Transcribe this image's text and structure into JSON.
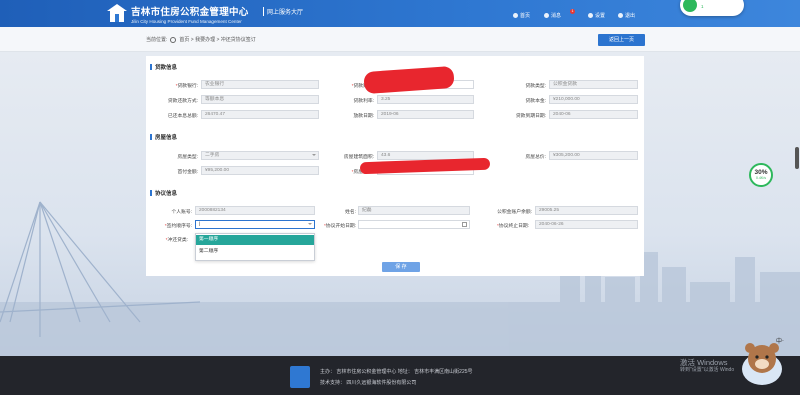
{
  "header": {
    "title_cn": "吉林市住房公积金管理中心",
    "title_en": "Jilin City Housing Provident Fund Management Center",
    "sub": "网上服务大厅",
    "nav": [
      {
        "label": "首页",
        "icon": "home-icon"
      },
      {
        "label": "消息",
        "icon": "message-icon",
        "badge": "1"
      },
      {
        "label": "设置",
        "icon": "gear-icon"
      },
      {
        "label": "退出",
        "icon": "logout-icon"
      }
    ]
  },
  "network_widget": {
    "label": "1"
  },
  "breadcrumb": {
    "prefix": "当前位置:",
    "path": "首页 > 我要办理 > 冲还贷协议签订"
  },
  "back_button": "返回上一页",
  "loan": {
    "section_title": "贷款信息",
    "fields": [
      {
        "label": "贷款银行:",
        "required": true,
        "value": "农业银行"
      },
      {
        "label": "贷款账号:",
        "required": true,
        "value": ""
      },
      {
        "label": "贷款类型:",
        "required": false,
        "value": "公积金贷款"
      },
      {
        "label": "贷款还款方式:",
        "required": false,
        "value": "等额本息"
      },
      {
        "label": "贷款利率:",
        "required": false,
        "value": "3.25"
      },
      {
        "label": "贷款本金:",
        "required": false,
        "value": "¥210,000.00"
      },
      {
        "label": "已还本息总额:",
        "required": false,
        "value": "26470.47"
      },
      {
        "label": "放款日期:",
        "required": false,
        "value": "2019-06"
      },
      {
        "label": "贷款到期日期:",
        "required": false,
        "value": "2040-06"
      }
    ]
  },
  "house": {
    "section_title": "房屋信息",
    "fields": [
      {
        "label": "房屋类型:",
        "required": false,
        "value": "二手房"
      },
      {
        "label": "房屋建筑面积:",
        "required": false,
        "value": "43.6"
      },
      {
        "label": "房屋总价:",
        "required": false,
        "value": "¥305,200.00"
      },
      {
        "label": "首付金额:",
        "required": false,
        "value": "¥95,200.00"
      },
      {
        "label": "房屋地址:",
        "required": true,
        "value": ""
      }
    ]
  },
  "agreement": {
    "section_title": "协议信息",
    "fields": [
      {
        "label": "个人账号:",
        "required": false,
        "value": "2000882134"
      },
      {
        "label": "姓名:",
        "required": false,
        "value": "纪磊"
      },
      {
        "label": "公积金账户余额:",
        "required": false,
        "value": "29005.25"
      },
      {
        "label": "签约顺序号:",
        "required": true,
        "value": "|"
      },
      {
        "label": "协议开始日期:",
        "required": true,
        "value": ""
      },
      {
        "label": "协议终止日期:",
        "required": true,
        "value": "2040-06-26"
      },
      {
        "label": "冲还贷类:",
        "required": true,
        "value": ""
      }
    ],
    "dropdown_options": [
      "第一顺序",
      "第二顺序"
    ]
  },
  "save_button": "保 存",
  "speed_widget": {
    "percent": "30%",
    "speed": "0.4K/s"
  },
  "footer": {
    "line1": "主办：  吉林市住房公积金管理中心  地址：  吉林市丰满区南山街225号",
    "line2": "技术支持：  四川久远银海软件股份有限公司",
    "activate1": "激活 Windows",
    "activate2": "转到\"设置\"以激活 Windo"
  }
}
